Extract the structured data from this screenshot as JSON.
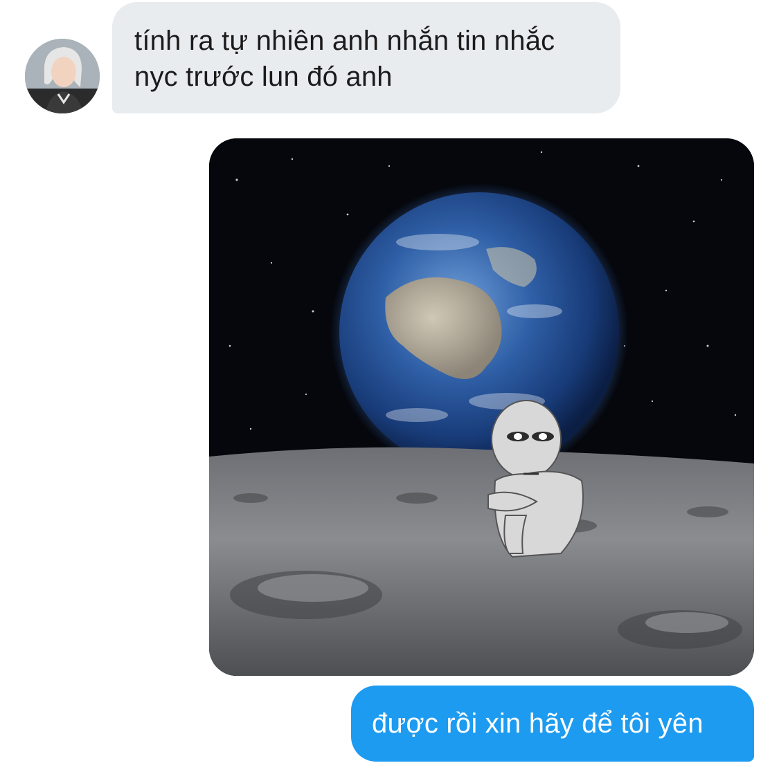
{
  "conversation": {
    "incoming": {
      "avatar_icon": "user-avatar",
      "lines": [
        "tính ra tự nhiên anh nhắn tin nhắc",
        "nyc trước lun đó anh"
      ]
    },
    "outgoing_image": {
      "subject": "earth-over-moon-sticker"
    },
    "outgoing": {
      "text": "được rồi xin hãy để tôi yên"
    }
  },
  "colors": {
    "incoming_bubble": "#e9ecef",
    "outgoing_bubble": "#1d9bf0",
    "background": "#ffffff"
  }
}
